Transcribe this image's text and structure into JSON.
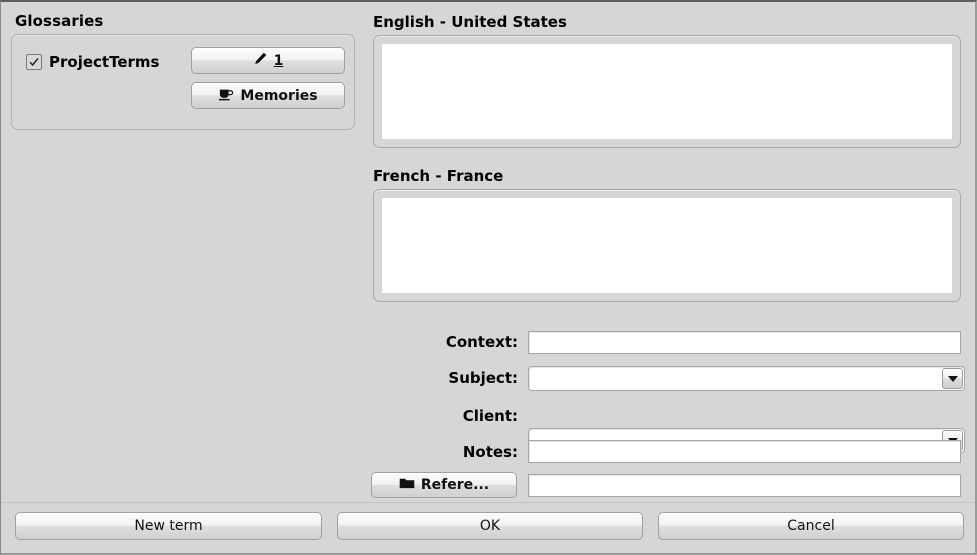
{
  "glossaries": {
    "title": "Glossaries",
    "checkbox_label": "ProjectTerms",
    "checkbox_checked": true,
    "edit_button_label": "1",
    "memories_button_label": "Memories"
  },
  "source": {
    "label": "English - United States",
    "value": "",
    "caret_visible": true
  },
  "target": {
    "label": "French - France",
    "value": ""
  },
  "fields": {
    "context": {
      "label": "Context:",
      "value": ""
    },
    "subject": {
      "label": "Subject:",
      "value": ""
    },
    "client": {
      "label": "Client:",
      "value": ""
    },
    "notes": {
      "label": "Notes:",
      "value": ""
    },
    "reference": {
      "button_label": "Refere...",
      "value": ""
    }
  },
  "buttons": {
    "new_term": "New term",
    "ok": "OK",
    "cancel": "Cancel"
  },
  "icons": {
    "pencil": "pencil-icon",
    "cup": "coffee-cup-icon",
    "folder": "folder-icon",
    "chevron_down": "chevron-down-icon",
    "check": "check-icon"
  },
  "colors": {
    "dialog_background": "#d6d6d6",
    "field_background": "#ffffff",
    "border": "#a6a6a6",
    "text": "#000000"
  }
}
